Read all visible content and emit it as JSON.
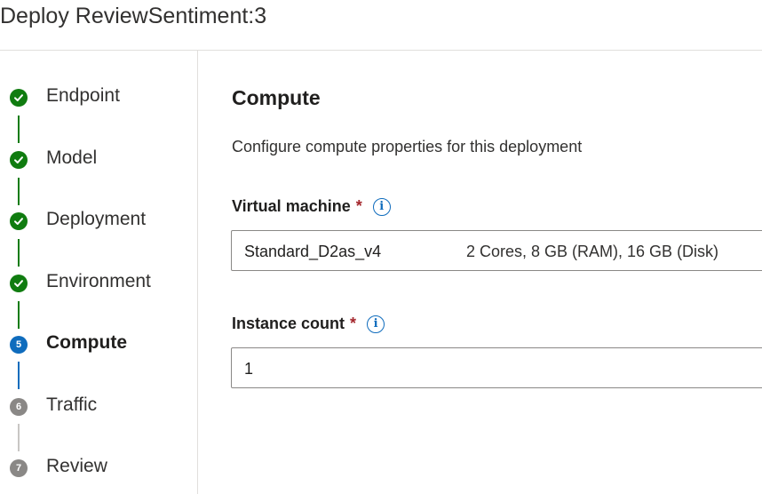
{
  "header": {
    "title": "Deploy ReviewSentiment:3"
  },
  "steps": [
    {
      "label": "Endpoint",
      "status": "done",
      "icon": "checkmark-icon"
    },
    {
      "label": "Model",
      "status": "done",
      "icon": "checkmark-icon"
    },
    {
      "label": "Deployment",
      "status": "done",
      "icon": "checkmark-icon"
    },
    {
      "label": "Environment",
      "status": "done",
      "icon": "checkmark-icon"
    },
    {
      "label": "Compute",
      "status": "current",
      "number": "5"
    },
    {
      "label": "Traffic",
      "status": "pending",
      "number": "6"
    },
    {
      "label": "Review",
      "status": "pending",
      "number": "7"
    }
  ],
  "main": {
    "title": "Compute",
    "description": "Configure compute properties for this deployment",
    "virtual_machine": {
      "label": "Virtual machine",
      "required_marker": "*",
      "info_icon": "info-icon",
      "value_name": "Standard_D2as_v4",
      "value_spec": "2 Cores, 8 GB (RAM), 16 GB (Disk)"
    },
    "instance_count": {
      "label": "Instance count",
      "required_marker": "*",
      "info_icon": "info-icon",
      "value": "1"
    }
  },
  "colors": {
    "done": "#107c10",
    "current": "#0f6cbd",
    "pending": "#8a8886",
    "required": "#a4262c"
  }
}
